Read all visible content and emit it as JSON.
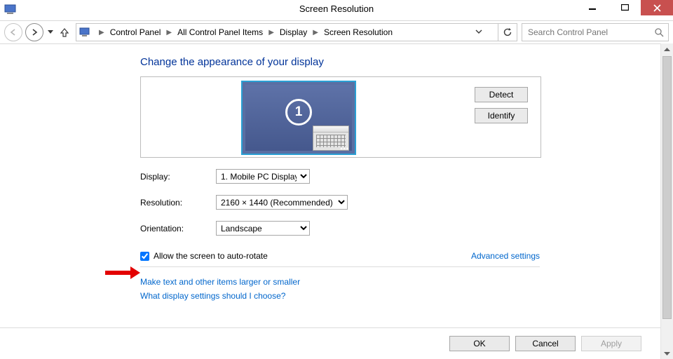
{
  "title": "Screen Resolution",
  "breadcrumb": [
    "Control Panel",
    "All Control Panel Items",
    "Display",
    "Screen Resolution"
  ],
  "search_placeholder": "Search Control Panel",
  "heading": "Change the appearance of your display",
  "monitor_number": "1",
  "detect_label": "Detect",
  "identify_label": "Identify",
  "labels": {
    "display": "Display:",
    "resolution": "Resolution:",
    "orientation": "Orientation:"
  },
  "selects": {
    "display": "1. Mobile PC Display",
    "resolution": "2160 × 1440 (Recommended)",
    "orientation": "Landscape"
  },
  "checkbox_label": "Allow the screen to auto-rotate",
  "links": {
    "advanced": "Advanced settings",
    "scale": "Make text and other items larger or smaller",
    "help": "What display settings should I choose?"
  },
  "buttons": {
    "ok": "OK",
    "cancel": "Cancel",
    "apply": "Apply"
  }
}
